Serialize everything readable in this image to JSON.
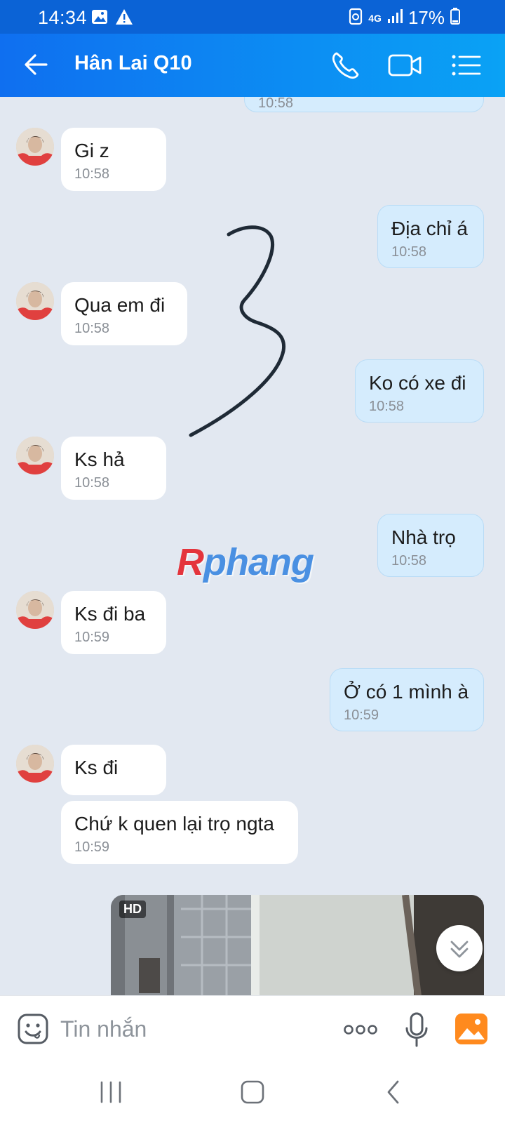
{
  "status_bar": {
    "time": "14:34",
    "network": "4G",
    "battery": "17%"
  },
  "header": {
    "contact_name": "Hân Lai Q10"
  },
  "messages": [
    {
      "side": "out",
      "text": "",
      "time": "10:58"
    },
    {
      "side": "in",
      "text": "Gi z",
      "time": "10:58"
    },
    {
      "side": "out",
      "text": "Địa chỉ á",
      "time": "10:58"
    },
    {
      "side": "in",
      "text": "Qua em đi",
      "time": "10:58"
    },
    {
      "side": "out",
      "text": "Ko có xe đi",
      "time": "10:58"
    },
    {
      "side": "in",
      "text": "Ks hả",
      "time": "10:58"
    },
    {
      "side": "out",
      "text": "Nhà trọ",
      "time": "10:58"
    },
    {
      "side": "in",
      "text": "Ks đi ba",
      "time": "10:59"
    },
    {
      "side": "out",
      "text": "Ở có 1 mình à",
      "time": "10:59"
    },
    {
      "side": "in",
      "text": "Ks đi",
      "time": ""
    },
    {
      "side": "in",
      "text": "Chứ k quen lại trọ ngta",
      "time": "10:59"
    }
  ],
  "photo": {
    "badge": "HD"
  },
  "watermark": {
    "first": "R",
    "rest": "phang"
  },
  "composer": {
    "placeholder": "Tin nhắn"
  }
}
